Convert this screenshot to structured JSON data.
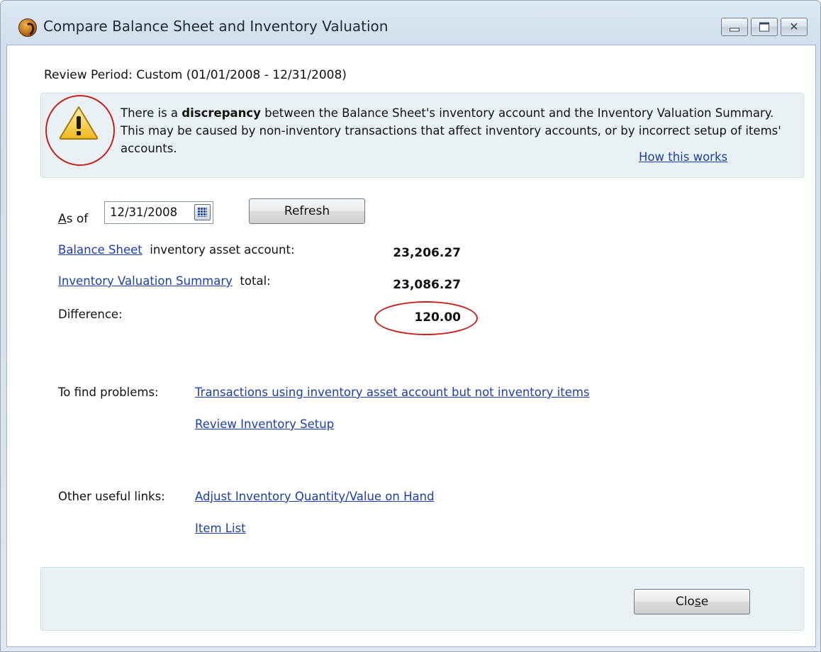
{
  "window": {
    "title": "Compare Balance Sheet and Inventory Valuation",
    "app_icon": "quickbooks-logo-icon",
    "controls": {
      "minimize_icon": "minimize-icon",
      "maximize_icon": "maximize-icon",
      "close_icon": "close-icon",
      "close_glyph": "✕"
    }
  },
  "review_period": "Review Period: Custom (01/01/2008 - 12/31/2008)",
  "alert": {
    "icon": "warning-icon",
    "text_before": "There is a ",
    "text_bold": "discrepancy",
    "text_after": " between the Balance Sheet's inventory account and the Inventory Valuation Summary. This may be caused by non-inventory transactions that affect inventory accounts, or by incorrect setup of items' accounts.",
    "help_link": "How this works",
    "highlight_color": "#c8201a",
    "panel_color": "#e9f1f5"
  },
  "as_of": {
    "label_accesskey": "A",
    "label_rest": "s of",
    "date_value": "12/31/2008",
    "calendar_icon": "calendar-icon",
    "refresh_label": "Refresh"
  },
  "comparison": {
    "balance_sheet_link": "Balance Sheet",
    "balance_sheet_text": "inventory asset account:",
    "balance_sheet_value": "23,206.27",
    "valuation_link": "Inventory Valuation Summary",
    "valuation_text": "total:",
    "valuation_value": "23,086.27",
    "difference_label": "Difference:",
    "difference_value": "120.00"
  },
  "find_problems": {
    "label": "To find problems:",
    "links": [
      "Transactions using inventory asset account but not inventory items",
      "Review Inventory Setup"
    ]
  },
  "other_links": {
    "label": "Other useful links:",
    "links": [
      "Adjust Inventory Quantity/Value on Hand",
      "Item List"
    ]
  },
  "footer": {
    "close_label_before": "Clo",
    "close_label_accesskey": "s",
    "close_label_after": "e"
  }
}
